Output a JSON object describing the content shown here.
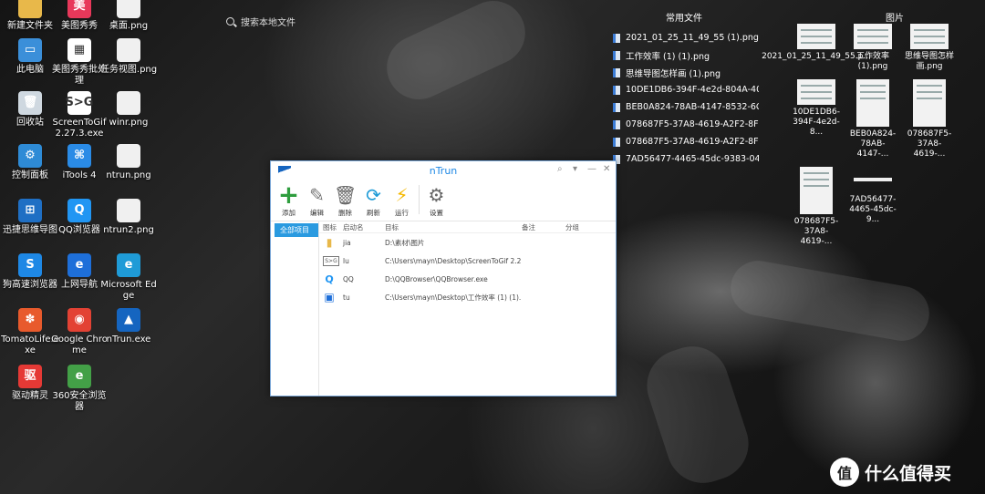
{
  "desktop_icons": [
    {
      "label": "新建文件夹",
      "icon": "folder-icon",
      "color": "#e8b84a",
      "glyph": ""
    },
    {
      "label": "美图秀秀",
      "icon": "meitu-icon",
      "color": "#e8385a",
      "glyph": "美"
    },
    {
      "label": "桌面.png",
      "icon": "image-file-icon",
      "color": "#f0f0f0",
      "glyph": ""
    },
    {
      "label": "此电脑",
      "icon": "computer-icon",
      "color": "#3b8fd9",
      "glyph": "▭"
    },
    {
      "label": "美图秀秀批处理",
      "icon": "meitu-batch-icon",
      "color": "#ffffff",
      "glyph": "▦"
    },
    {
      "label": "任务视图.png",
      "icon": "image-file-icon",
      "color": "#f0f0f0",
      "glyph": ""
    },
    {
      "label": "回收站",
      "icon": "recycle-bin-icon",
      "color": "#cfd8e0",
      "glyph": "🗑"
    },
    {
      "label": "ScreenToGif 2.27.3.exe",
      "icon": "screentogif-icon",
      "color": "#ffffff",
      "glyph": "S>G"
    },
    {
      "label": "winr.png",
      "icon": "image-file-icon",
      "color": "#f0f0f0",
      "glyph": ""
    },
    {
      "label": "控制面板",
      "icon": "control-panel-icon",
      "color": "#2e8bd6",
      "glyph": "⚙"
    },
    {
      "label": "iTools 4",
      "icon": "itools-icon",
      "color": "#2a8be6",
      "glyph": "⌘"
    },
    {
      "label": "ntrun.png",
      "icon": "image-file-icon",
      "color": "#f0f0f0",
      "glyph": ""
    },
    {
      "label": "迅捷思维导图",
      "icon": "mindmap-icon",
      "color": "#1f6fc4",
      "glyph": "⊞"
    },
    {
      "label": "QQ浏览器",
      "icon": "qq-browser-icon",
      "color": "#2196f3",
      "glyph": "Q"
    },
    {
      "label": "ntrun2.png",
      "icon": "image-file-icon",
      "color": "#f0f0f0",
      "glyph": ""
    },
    {
      "label": "狗高速浏览器",
      "icon": "sogou-browser-icon",
      "color": "#1e88e5",
      "glyph": "S"
    },
    {
      "label": "上网导航",
      "icon": "web-nav-icon",
      "color": "#1e6fd9",
      "glyph": "e"
    },
    {
      "label": "Microsoft Edge",
      "icon": "edge-icon",
      "color": "#1f9bd7",
      "glyph": "e"
    },
    {
      "label": "TomatoLife.exe",
      "icon": "tomato-icon",
      "color": "#e85a2c",
      "glyph": "✽"
    },
    {
      "label": "Google Chrome",
      "icon": "chrome-icon",
      "color": "#e34234",
      "glyph": "◉"
    },
    {
      "label": "nTrun.exe",
      "icon": "ntrun-icon",
      "color": "#1565c0",
      "glyph": "▲"
    },
    {
      "label": "驱动精灵",
      "icon": "driver-genius-icon",
      "color": "#e53935",
      "glyph": "驱"
    },
    {
      "label": "360安全浏览器",
      "icon": "browser-360-icon",
      "color": "#43a047",
      "glyph": "e"
    }
  ],
  "search": {
    "placeholder": "搜索本地文件"
  },
  "recent_files": {
    "title": "常用文件",
    "items": [
      "2021_01_25_11_49_55 (1).png",
      "工作效率 (1) (1).png",
      "思维导图怎样画 (1).png",
      "10DE1DB6-394F-4e2d-804A-40...",
      "BEB0A824-78AB-4147-8532-6C...",
      "078687F5-37A8-4619-A2F2-8FC...",
      "078687F5-37A8-4619-A2F2-8FC...",
      "7AD56477-4465-45dc-9383-04..."
    ]
  },
  "pictures": {
    "title": "图片",
    "items": [
      {
        "label": "2021_01_25_11_49_55.p...",
        "shape": "wide"
      },
      {
        "label": "工作效率 (1).png",
        "shape": "wide"
      },
      {
        "label": "思维导图怎样画.png",
        "shape": "wide"
      },
      {
        "label": "10DE1DB6-394F-4e2d-8...",
        "shape": "wide"
      },
      {
        "label": "BEB0A824-78AB-4147-...",
        "shape": "tall"
      },
      {
        "label": "078687F5-37A8-4619-...",
        "shape": "tall"
      },
      {
        "label": "078687F5-37A8-4619-...",
        "shape": "tall"
      },
      {
        "label": "7AD56477-4465-45dc-9...",
        "shape": "strip"
      }
    ]
  },
  "window": {
    "title": "nTrun",
    "toolbar": [
      {
        "label": "添加",
        "icon": "plus-icon",
        "glyph": "+",
        "color": "#2e9d3e"
      },
      {
        "label": "编辑",
        "icon": "pencil-icon",
        "glyph": "✎",
        "color": "#777777"
      },
      {
        "label": "删除",
        "icon": "trash-icon",
        "glyph": "🗑",
        "color": "#666666"
      },
      {
        "label": "刷新",
        "icon": "refresh-icon",
        "glyph": "⟳",
        "color": "#1e9bd7"
      },
      {
        "label": "运行",
        "icon": "lightning-icon",
        "glyph": "⚡",
        "color": "#f5b800"
      },
      {
        "label": "设置",
        "icon": "gear-icon",
        "glyph": "⚙",
        "color": "#666666"
      }
    ],
    "category": "全部项目",
    "columns": {
      "icon": "图标",
      "name": "启动名",
      "target": "目标",
      "note": "备注",
      "group": "分组"
    },
    "rows": [
      {
        "name": "jia",
        "target": "D:\\素材\\图片",
        "icon": "folder-icon",
        "glyph": "▮",
        "color": "#e8b84a"
      },
      {
        "name": "lu",
        "target": "C:\\Users\\mayn\\Desktop\\ScreenToGif 2.2...",
        "icon": "screentogif-icon",
        "glyph": "S>G",
        "color": "#555555"
      },
      {
        "name": "QQ",
        "target": "D:\\QQBrowser\\QQBrowser.exe",
        "icon": "qq-browser-icon",
        "glyph": "Q",
        "color": "#2196f3"
      },
      {
        "name": "tu",
        "target": "C:\\Users\\mayn\\Desktop\\工作效率 (1) (1)...",
        "icon": "image-file-icon",
        "glyph": "▣",
        "color": "#1e6fd9"
      }
    ]
  },
  "watermark": {
    "badge": "值",
    "text": "什么值得买"
  }
}
